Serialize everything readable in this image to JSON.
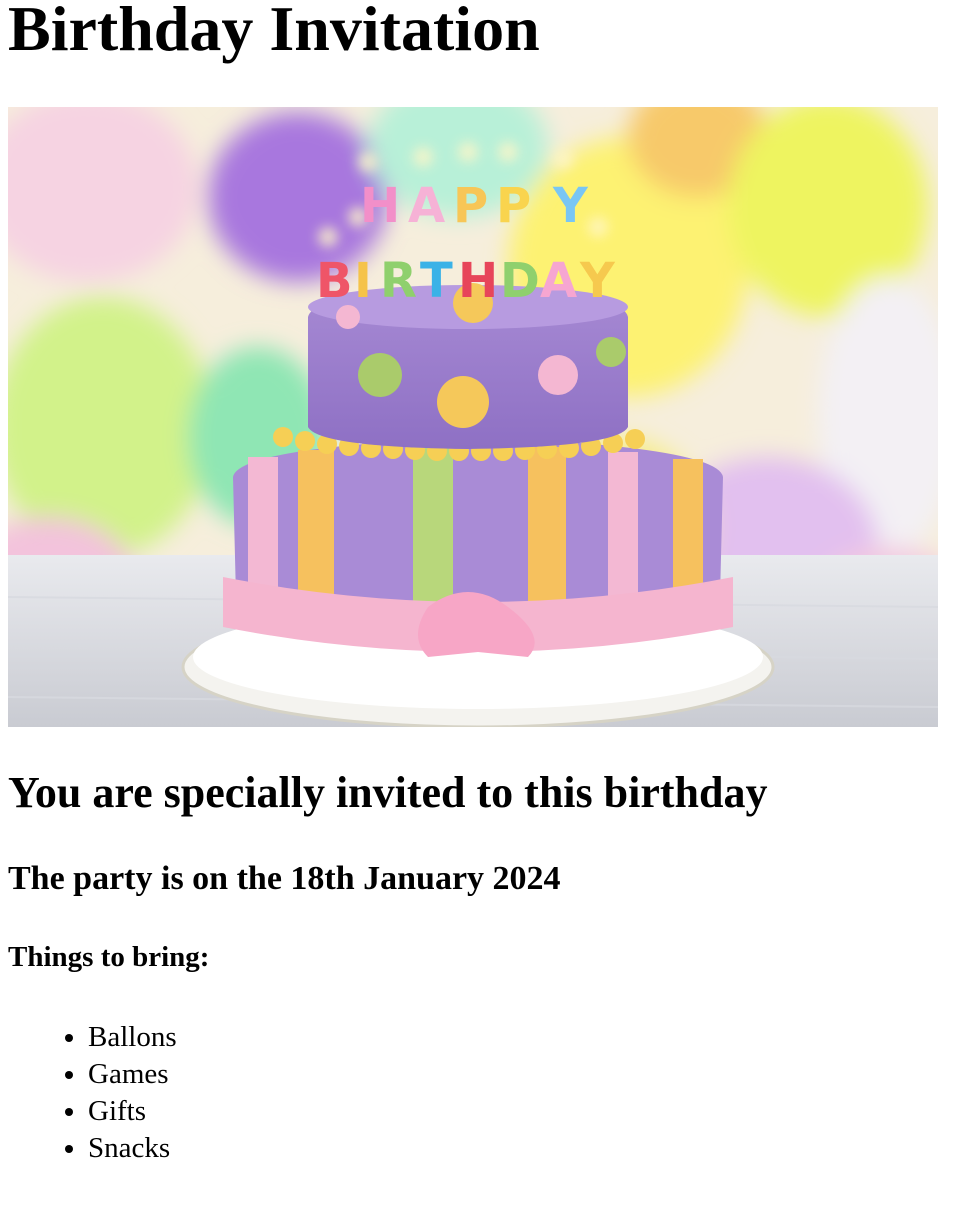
{
  "page": {
    "title": "Birthday Invitation",
    "invite_heading": "You are specially invited to this birthday",
    "date_heading": "The party is on the 18th January 2024",
    "bring_heading": "Things to bring:",
    "items": [
      "Ballons",
      "Games",
      "Gifts",
      "Snacks"
    ]
  },
  "image": {
    "candle_text_top": "HAPPY",
    "candle_text_bottom": "BIRTHDAY"
  }
}
